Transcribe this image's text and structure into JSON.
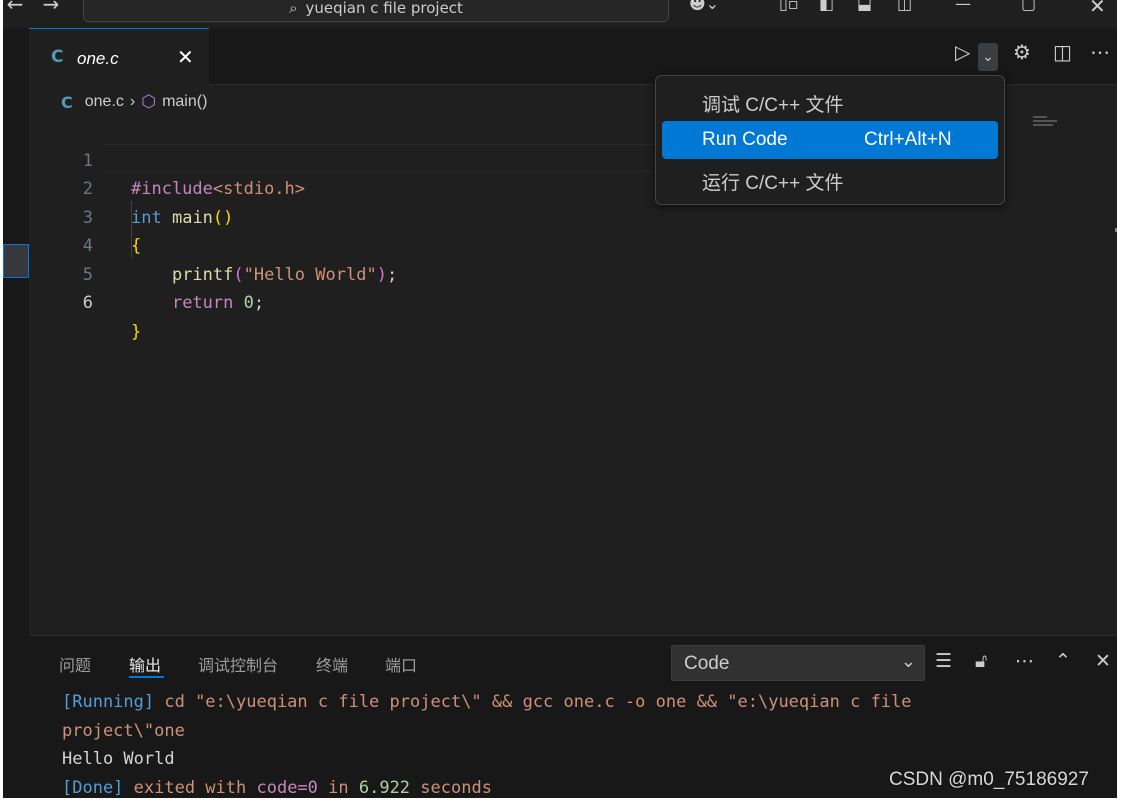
{
  "titlebar": {
    "search_text": "yueqian c file project"
  },
  "tab": {
    "icon_letter": "C",
    "label": "one.c",
    "close": "✕"
  },
  "breadcrumb": {
    "icon_letter": "C",
    "file": "one.c",
    "separator": "›",
    "symbol": "main()"
  },
  "editor": {
    "line_numbers": [
      "1",
      "2",
      "3",
      "4",
      "5",
      "6"
    ],
    "active_line": "6",
    "lines": [
      "#include<stdio.h>",
      "int main()",
      "{",
      "    printf(\"Hello World\");",
      "    return 0;",
      "}"
    ]
  },
  "run_menu": {
    "items": [
      {
        "label": "调试 C/C++ 文件",
        "shortcut": ""
      },
      {
        "label": "Run Code",
        "shortcut": "Ctrl+Alt+N",
        "selected": true
      },
      {
        "label": "运行 C/C++ 文件",
        "shortcut": ""
      }
    ]
  },
  "panel": {
    "tabs": [
      "问题",
      "输出",
      "调试控制台",
      "终端",
      "端口"
    ],
    "active_tab": "输出",
    "output_channel": "Code",
    "output": {
      "line1_a": "[Running]",
      "line1_b": " cd \"e:\\yueqian c file project\\\" && gcc one.c -o one && \"e:\\yueqian c file",
      "line2": "project\\\"one",
      "line3": "Hello World",
      "line4_done": "[Done]",
      "line4_exited": " exited with ",
      "line4_code": "code=0",
      "line4_in": " in ",
      "line4_time": "6.922",
      "line4_seconds": " seconds"
    }
  },
  "watermark": "CSDN @m0_75186927",
  "colors": {
    "accent": "#0078d4",
    "editor_bg": "#1f1f1f",
    "panel_bg": "#181818"
  }
}
